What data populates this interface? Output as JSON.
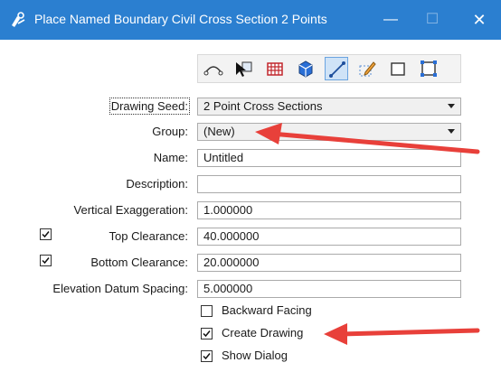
{
  "window": {
    "title": "Place Named Boundary Civil Cross Section 2 Points",
    "minimize_glyph": "—",
    "maximize_glyph": "☐",
    "close_glyph": "✕"
  },
  "toolbar": {
    "tools": [
      {
        "name": "alignment-tool-icon",
        "active": false
      },
      {
        "name": "pick-element-tool-icon",
        "active": false
      },
      {
        "name": "grid-table-tool-icon",
        "active": false
      },
      {
        "name": "cube-tool-icon",
        "active": false
      },
      {
        "name": "two-point-line-tool-icon",
        "active": true
      },
      {
        "name": "pencil-tool-icon",
        "active": false
      },
      {
        "name": "rectangle-tool-icon",
        "active": false
      },
      {
        "name": "shape-corner-tool-icon",
        "active": false
      }
    ]
  },
  "form": {
    "drawing_seed": {
      "label": "Drawing Seed:",
      "value": "2 Point Cross Sections"
    },
    "group": {
      "label": "Group:",
      "value": "(New)"
    },
    "name": {
      "label": "Name:",
      "value": "Untitled"
    },
    "description": {
      "label": "Description:",
      "value": ""
    },
    "vertical_exaggeration": {
      "label": "Vertical Exaggeration:",
      "value": "1.000000"
    },
    "top_clearance": {
      "label": "Top Clearance:",
      "value": "40.000000",
      "checked": true
    },
    "bottom_clearance": {
      "label": "Bottom Clearance:",
      "value": "20.000000",
      "checked": true
    },
    "elevation_datum_spacing": {
      "label": "Elevation Datum Spacing:",
      "value": "5.000000"
    }
  },
  "options": {
    "backward_facing": {
      "label": "Backward Facing",
      "checked": false
    },
    "create_drawing": {
      "label": "Create Drawing",
      "checked": true
    },
    "show_dialog": {
      "label": "Show Dialog",
      "checked": true
    }
  },
  "colors": {
    "titlebar": "#2b7fd0",
    "annotation_arrow": "#e8403a"
  }
}
